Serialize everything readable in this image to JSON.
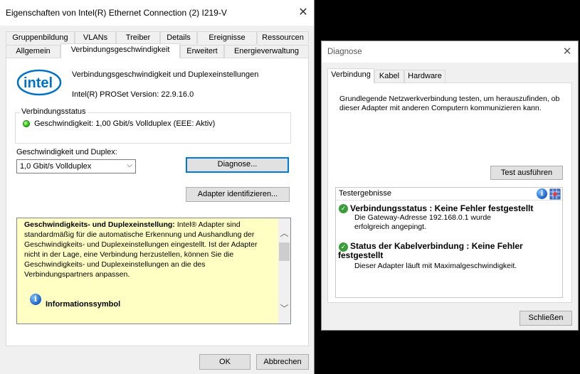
{
  "main_dialog": {
    "title": "Eigenschaften von Intel(R) Ethernet Connection (2) I219-V",
    "close_glyph": "✕",
    "tabs_row1": [
      "Gruppenbildung",
      "VLANs",
      "Treiber",
      "Details",
      "Ereignisse",
      "Ressourcen"
    ],
    "tabs_row2": [
      "Allgemein",
      "Verbindungsgeschwindigkeit",
      "Erweitert",
      "Energieverwaltung"
    ],
    "active_tab": "Verbindungsgeschwindigkeit",
    "logo_text": "intel",
    "heading": "Verbindungsgeschwindigkeit und Duplexeinstellungen",
    "version": "Intel(R) PROSet Version: 22.9.16.0",
    "status_group": {
      "legend": "Verbindungsstatus",
      "text": "Geschwindigkeit: 1,00 Gbit/s Vollduplex (EEE: Aktiv)",
      "led_color": "#2ec40e"
    },
    "speed_label": "Geschwindigkeit und Duplex:",
    "speed_select": {
      "value": "1,0 Gbit/s Vollduplex"
    },
    "diagnose_button": "Diagnose...",
    "identify_button": "Adapter identifizieren...",
    "help": {
      "bold_lead": "Geschwindigkeits- und Duplexeinstellung:",
      "body": " Intel® Adapter sind standardmäßig für die automatische Erkennung und Aushandlung der Geschwindigkeits- und Duplexeinstellungen eingestellt. Ist der Adapter nicht in der Lage, eine Verbindung herzustellen, können Sie die Geschwindigkeits- und Duplexeinstellungen an die des Verbindungspartners anpassen.",
      "info_heading": "Informationssymbol",
      "background": "#ffffc4"
    },
    "ok_button": "OK",
    "cancel_button": "Abbrechen"
  },
  "diag_dialog": {
    "title": "Diagnose",
    "close_glyph": "✕",
    "tabs": [
      "Verbindung",
      "Kabel",
      "Hardware"
    ],
    "active_tab": "Verbindung",
    "description": "Grundlegende Netzwerkverbindung testen, um herauszufinden, ob dieser Adapter mit anderen Computern kommunizieren kann.",
    "run_button": "Test ausführen",
    "results": {
      "header": "Testergebnisse",
      "item1_title": "Verbindungsstatus : Keine Fehler festgestellt",
      "item1_detail": "Die Gateway-Adresse 192.168.0.1 wurde erfolgreich angepingt.",
      "item2_title": "Status der Kabelverbindung : Keine Fehler festgestellt",
      "item2_detail": "Dieser Adapter läuft mit Maximalgeschwindigkeit."
    },
    "close_button": "Schließen"
  },
  "colors": {
    "accent": "#0078d7",
    "success": "#3a9c3a",
    "intel_blue": "#0071c5"
  }
}
